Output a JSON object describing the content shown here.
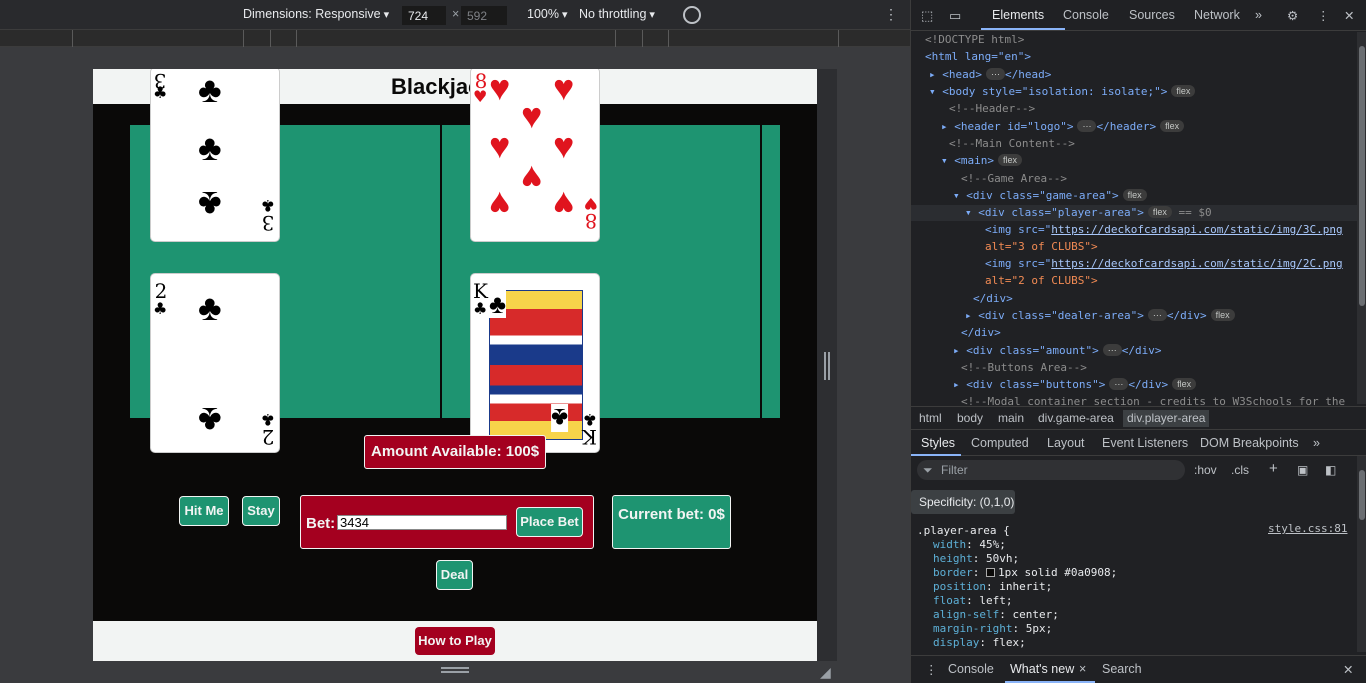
{
  "toolbar": {
    "dimensions_label": "Dimensions: Responsive",
    "width": "724",
    "height": "592",
    "times": "×",
    "zoom": "100%",
    "throttling": "No throttling"
  },
  "page": {
    "title": "Blackjack",
    "logo_glyph": "♠",
    "amount_available": "Amount Available: 100$",
    "hit_label": "Hit Me",
    "stay_label": "Stay",
    "bet_label": "Bet:",
    "bet_value": "3434",
    "place_bet_label": "Place Bet",
    "current_bet": "Current bet: 0$",
    "deal_label": "Deal",
    "how_to_play_label": "How to Play",
    "colors": {
      "felt": "#1e9471",
      "red_panel": "#a4001f",
      "background": "#0a0908",
      "light": "#f2f4f3"
    },
    "player_cards": [
      {
        "rank": "3",
        "suit": "♣",
        "alt": "3 of CLUBS",
        "color": "black"
      },
      {
        "rank": "2",
        "suit": "♣",
        "alt": "2 of CLUBS",
        "color": "black"
      }
    ],
    "dealer_cards": [
      {
        "rank": "8",
        "suit": "♥",
        "color": "red"
      },
      {
        "rank": "K",
        "suit": "♣",
        "color": "black"
      }
    ]
  },
  "devtools": {
    "tabs": [
      "Elements",
      "Console",
      "Sources",
      "Network"
    ],
    "more": "»",
    "dom": {
      "doctype": "<!DOCTYPE html>",
      "html_open": "<html lang=\"en\">",
      "head": "<head>",
      "head_close": "</head>",
      "body": "<body style=\"isolation: isolate;\">",
      "c_header": "<!--Header-->",
      "header": "<header id=\"logo\">",
      "header_close": "</header>",
      "c_main": "<!--Main Content-->",
      "main": "<main>",
      "c_game": "<!--Game Area-->",
      "game_area": "<div class=\"game-area\">",
      "player_area": "<div class=\"player-area\">",
      "eq": "== $0",
      "img1_pre": "<img src=\"",
      "img1_src": "https://deckofcardsapi.com/static/img/3C.png",
      "img1_alt": "alt=\"3 of CLUBS\">",
      "img2_src": "https://deckofcardsapi.com/static/img/2C.png",
      "img2_alt": "alt=\"2 of CLUBS\">",
      "div_close": "</div>",
      "dealer_area": "<div class=\"dealer-area\">",
      "div_close2": "</div>",
      "amount": "<div class=\"amount\">",
      "amount_close": "</div>",
      "c_buttons": "<!--Buttons Area-->",
      "buttons": "<div class=\"buttons\">",
      "buttons_close": "</div>",
      "c_modal": "<!--Modal container section - credits to W3Schools for the",
      "badge_flex": "flex",
      "ellipsis": "⋯"
    },
    "breadcrumbs": [
      "html",
      "body",
      "main",
      "div.game-area",
      "div.player-area"
    ],
    "style_tabs": [
      "Styles",
      "Computed",
      "Layout",
      "Event Listeners",
      "DOM Breakpoints"
    ],
    "filter_placeholder": "Filter",
    "hov": ":hov",
    "cls": ".cls",
    "specificity": "Specificity: (0,1,0)",
    "rule": {
      "selector": ".player-area {",
      "source": "style.css:81",
      "props": [
        {
          "name": "width",
          "value": "45%;"
        },
        {
          "name": "height",
          "value": "50vh;"
        },
        {
          "name": "border",
          "value": "1px solid #0a0908;"
        },
        {
          "name": "position",
          "value": "inherit;"
        },
        {
          "name": "float",
          "value": "left;"
        },
        {
          "name": "align-self",
          "value": "center;"
        },
        {
          "name": "margin-right",
          "value": "5px;"
        },
        {
          "name": "display",
          "value": "flex;"
        }
      ]
    },
    "drawer": {
      "console": "Console",
      "whats_new": "What's new",
      "close": "×",
      "search": "Search"
    }
  }
}
